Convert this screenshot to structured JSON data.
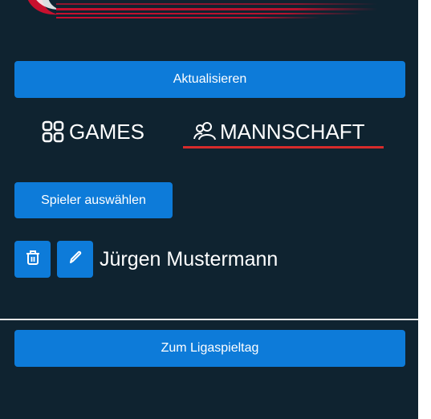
{
  "header": {
    "logo_icon": "red-swoosh-logo"
  },
  "actions": {
    "refresh_label": "Aktualisieren",
    "select_players_label": "Spieler auswählen",
    "league_matchday_label": "Zum Ligaspieltag"
  },
  "tabs": [
    {
      "label": "GAMES",
      "icon": "grid-icon",
      "active": false
    },
    {
      "label": "MANNSCHAFT",
      "icon": "users-icon",
      "active": true
    }
  ],
  "team": {
    "players": [
      {
        "name": "Jürgen Mustermann"
      }
    ]
  },
  "colors": {
    "background": "#0f2330",
    "primary_button": "#0d7bd9",
    "active_tab_underline": "#d62b2b",
    "text": "#ffffff"
  }
}
